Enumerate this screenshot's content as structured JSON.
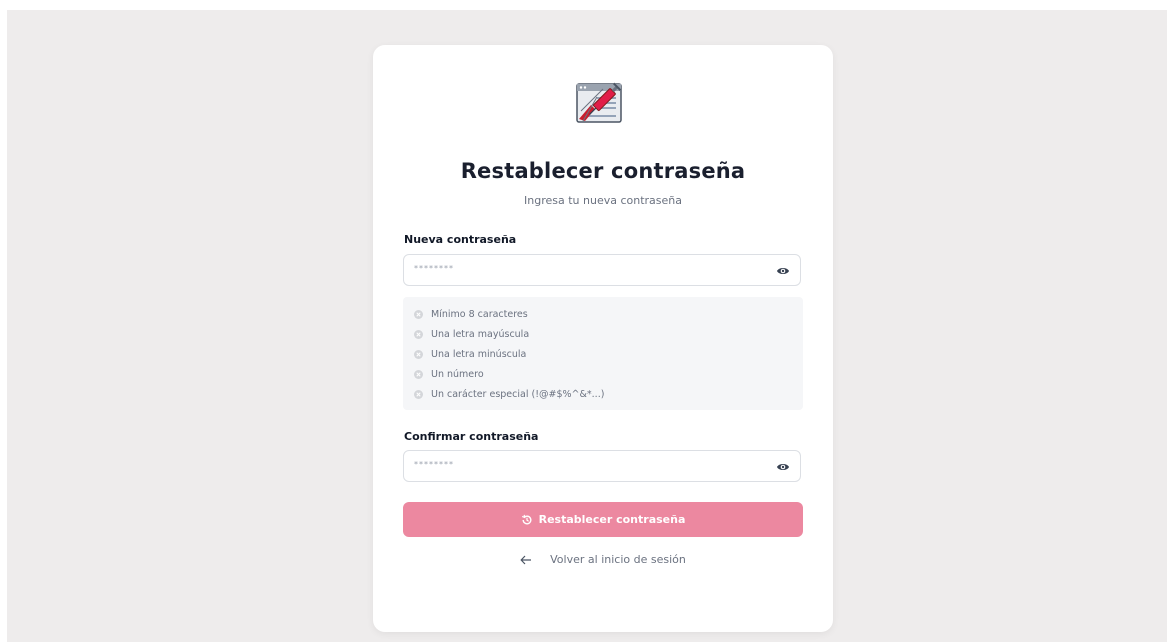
{
  "page": {
    "title": "Restablecer contraseña",
    "subtitle": "Ingresa tu nueva contraseña"
  },
  "new_password": {
    "label": "Nueva contraseña",
    "value": "********"
  },
  "requirements": [
    {
      "text": "Mínimo 8 caracteres",
      "met": false
    },
    {
      "text": "Una letra mayúscula",
      "met": false
    },
    {
      "text": "Una letra minúscula",
      "met": false
    },
    {
      "text": "Un número",
      "met": false
    },
    {
      "text": "Un carácter especial (!@#$%^&*...)",
      "met": false
    }
  ],
  "confirm_password": {
    "label": "Confirmar contraseña",
    "value": "********"
  },
  "submit_button": {
    "label": "Restablecer contraseña"
  },
  "back_link": {
    "label": "Volver al inicio de sesión"
  },
  "icons": {
    "logo": "syringe-browser-logo",
    "toggle": "eye-icon",
    "submit": "reset-icon",
    "back": "arrow-left-icon"
  },
  "colors": {
    "accent": "#ec88a0",
    "background": "#eeecec",
    "card": "#ffffff"
  }
}
